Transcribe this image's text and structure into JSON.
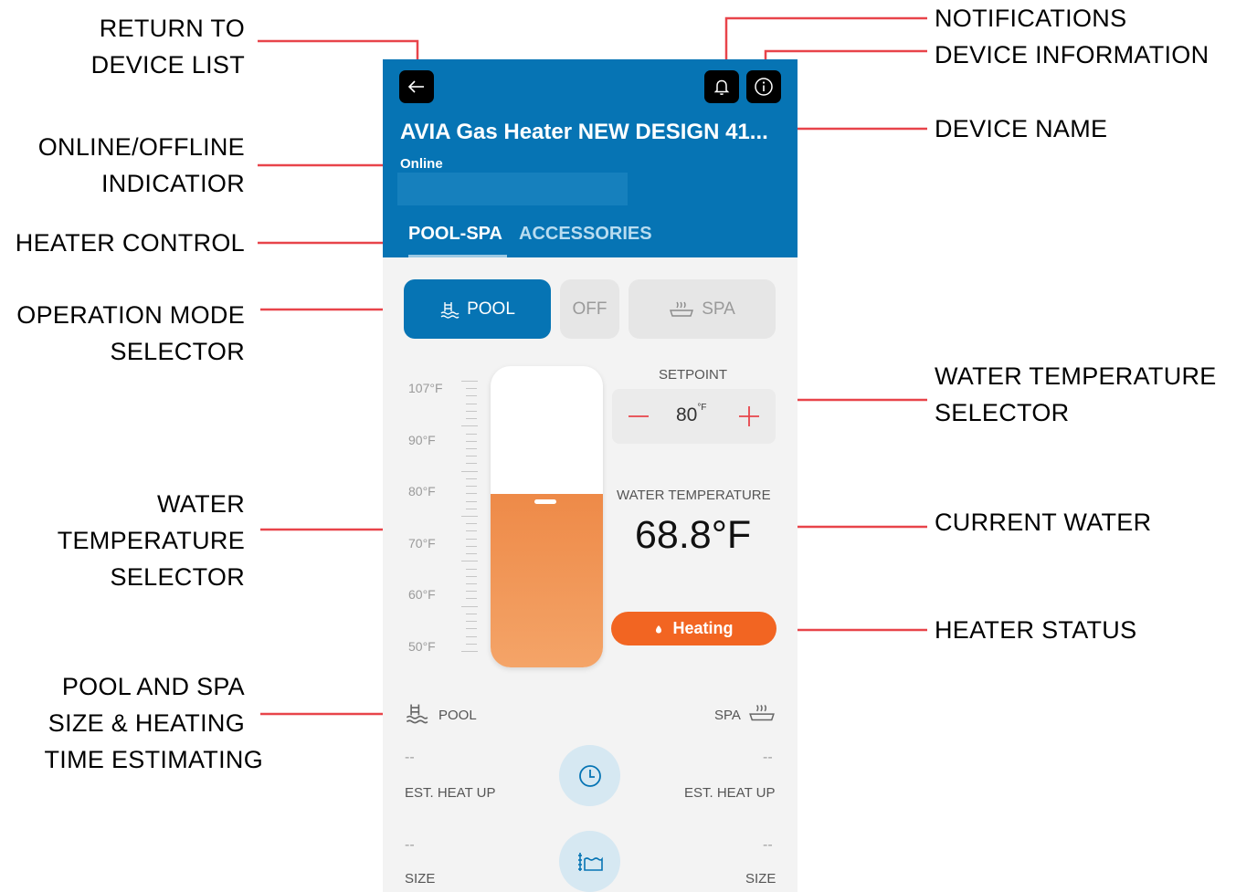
{
  "callouts": {
    "return": [
      "RETURN TO",
      "DEVICE LIST"
    ],
    "online": [
      "ONLINE/OFFLINE",
      "INDICATIOR"
    ],
    "heater_control": [
      "HEATER CONTROL"
    ],
    "operation_mode": [
      "OPERATION MODE",
      "SELECTOR"
    ],
    "water_temp_left": [
      "WATER",
      "TEMPERATURE",
      "SELECTOR"
    ],
    "pool_spa_size": [
      "POOL AND SPA",
      "SIZE & HEATING",
      "TIME ESTIMATING"
    ],
    "notifications": [
      "NOTIFICATIONS"
    ],
    "device_information": [
      "DEVICE INFORMATION"
    ],
    "device_name": [
      "DEVICE NAME"
    ],
    "water_temp_right": [
      "WATER TEMPERATURE",
      "SELECTOR"
    ],
    "current_water": [
      "CURRENT WATER"
    ],
    "heater_status": [
      "HEATER STATUS"
    ]
  },
  "header": {
    "device_name": "AVIA Gas Heater NEW DESIGN 41...",
    "status": "Online",
    "back_icon": "arrow-left-icon",
    "notification_icon": "bell-icon",
    "info_icon": "info-icon"
  },
  "tabs": [
    {
      "label": "POOL-SPA",
      "active": true
    },
    {
      "label": "ACCESSORIES",
      "active": false
    }
  ],
  "modes": [
    {
      "label": "POOL",
      "icon": "pool-icon",
      "active": true
    },
    {
      "label": "OFF",
      "active": false
    },
    {
      "label": "SPA",
      "icon": "spa-icon",
      "active": false
    }
  ],
  "scale": [
    "107°F",
    "90°F",
    "80°F",
    "70°F",
    "60°F",
    "50°F"
  ],
  "thermometer": {
    "min": 50,
    "max": 107,
    "current": 68.8,
    "setpoint": 80
  },
  "setpoint": {
    "label": "SETPOINT",
    "value": "80",
    "unit": "°F",
    "minus": "—",
    "plus": "+"
  },
  "water": {
    "label": "WATER TEMPERATURE",
    "value": "68.8°F"
  },
  "heater_status": {
    "label": "Heating",
    "icon": "flame-icon"
  },
  "estimates": {
    "pool_label": "POOL",
    "spa_label": "SPA",
    "pool_heat_value": "--",
    "spa_heat_value": "--",
    "heat_label": "EST. HEAT UP",
    "pool_size_value": "--",
    "spa_size_value": "--",
    "size_label": "SIZE",
    "clock_icon": "clock-icon",
    "size_icon": "pool-size-icon"
  },
  "colors": {
    "header_blue": "#0674b4",
    "accent_blue": "#0674b4",
    "heating_orange": "#f26522",
    "fill_orange": "#ee8a48",
    "leader_red": "#e8444a"
  }
}
